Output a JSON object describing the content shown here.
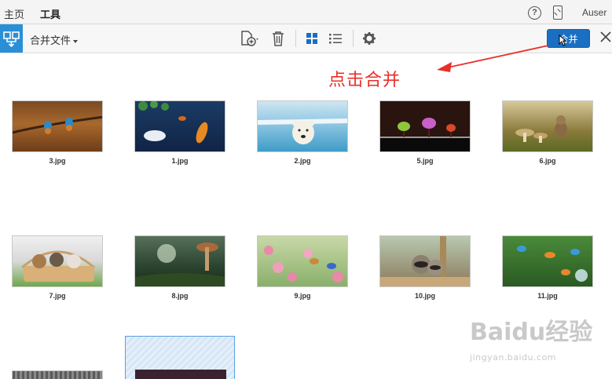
{
  "menubar": {
    "home_tab": "主页",
    "tools_tab": "工具",
    "user_name": "Auser"
  },
  "toolbar": {
    "title": "合并文件",
    "merge_button": "合并"
  },
  "annotation": {
    "text": "点击合并"
  },
  "files": [
    {
      "name": "3.jpg"
    },
    {
      "name": "1.jpg"
    },
    {
      "name": "2.jpg"
    },
    {
      "name": "5.jpg"
    },
    {
      "name": "6.jpg"
    },
    {
      "name": "7.jpg"
    },
    {
      "name": "8.jpg"
    },
    {
      "name": "9.jpg"
    },
    {
      "name": "10.jpg"
    },
    {
      "name": "11.jpg"
    }
  ],
  "watermark": {
    "main": "Baidu经验",
    "sub": "jingyan.baidu.com"
  },
  "colors": {
    "accent": "#1a6fc2",
    "annotation": "#e8302a"
  }
}
